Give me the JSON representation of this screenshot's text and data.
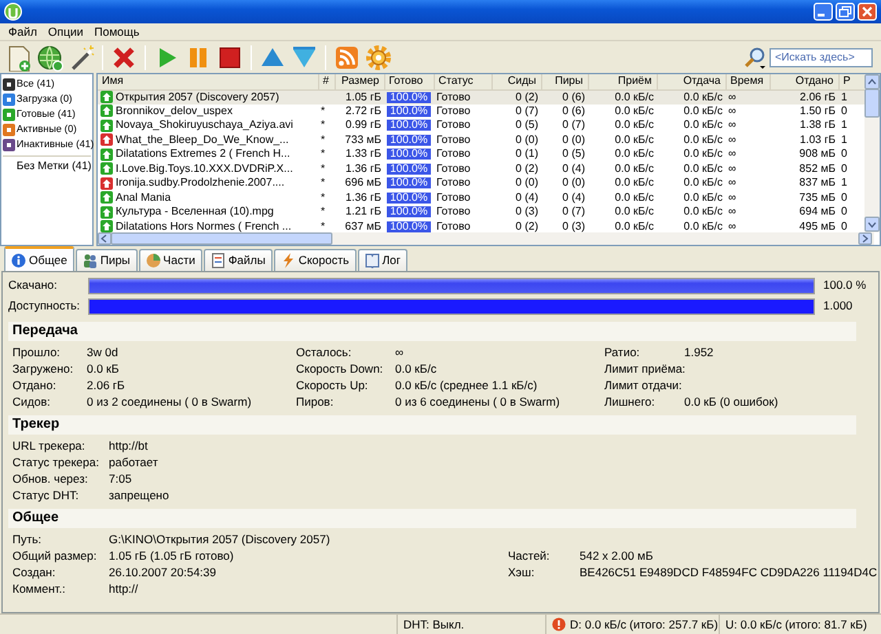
{
  "menu": [
    "Файл",
    "Опции",
    "Помощь"
  ],
  "search": {
    "placeholder": "<Искать здесь>"
  },
  "sidebar": {
    "items": [
      {
        "label": "Все (41)",
        "color": "#303030",
        "selected": false
      },
      {
        "label": "Загрузка (0)",
        "color": "#2f7fe0",
        "selected": false
      },
      {
        "label": "Готовые (41)",
        "color": "#2aa82a",
        "selected": false
      },
      {
        "label": "Активные (0)",
        "color": "#e07820",
        "selected": false
      },
      {
        "label": "Инактивные (41)",
        "color": "#6a4a8a",
        "selected": false
      }
    ],
    "labels": [
      {
        "label": "Без Метки (41)"
      }
    ]
  },
  "torrents": {
    "columns": [
      "Имя",
      "#",
      "Размер",
      "Готово",
      "Статус",
      "Сиды",
      "Пиры",
      "Приём",
      "Отдача",
      "Время",
      "Отдано",
      "Р"
    ],
    "rows": [
      {
        "kind": "done",
        "selected": true,
        "name": "Открытия 2057 (Discovery 2057)",
        "size": "1.05 гБ",
        "done": "100.0%",
        "level": 1,
        "status": "Готово",
        "seeds": "0 (2)",
        "peers": "0 (6)",
        "down": "0.0 кБ/с",
        "up": "0.0 кБ/с",
        "eta": "∞",
        "uploaded": "2.06 гБ",
        "column_12": "1"
      },
      {
        "kind": "done",
        "selected": false,
        "name": "Bronnikov_delov_uspex",
        "queue": "*",
        "size": "2.72 гБ",
        "done": "100.0%",
        "level": 1,
        "status": "Готово",
        "seeds": "0 (7)",
        "peers": "0 (6)",
        "down": "0.0 кБ/с",
        "up": "0.0 кБ/с",
        "eta": "∞",
        "uploaded": "1.50 гБ",
        "column_12": "0"
      },
      {
        "kind": "done",
        "selected": false,
        "name": "Novaya_Shokiruyuschaya_Aziya.avi",
        "queue": "*",
        "size": "0.99 гБ",
        "done": "100.0%",
        "level": 1,
        "status": "Готово",
        "seeds": "0 (5)",
        "peers": "0 (7)",
        "down": "0.0 кБ/с",
        "up": "0.0 кБ/с",
        "eta": "∞",
        "uploaded": "1.38 гБ",
        "column_12": "1"
      },
      {
        "kind": "error",
        "selected": false,
        "name": "What_the_Bleep_Do_We_Know_...",
        "queue": "*",
        "size": "733 мБ",
        "done": "100.0%",
        "level": 1,
        "status": "Готово",
        "seeds": "0 (0)",
        "peers": "0 (0)",
        "down": "0.0 кБ/с",
        "up": "0.0 кБ/с",
        "eta": "∞",
        "uploaded": "1.03 гБ",
        "column_12": "1"
      },
      {
        "kind": "done",
        "selected": false,
        "name": "Dilatations Extremes 2 ( French H...",
        "queue": "*",
        "size": "1.33 гБ",
        "done": "100.0%",
        "level": 1,
        "status": "Готово",
        "seeds": "0 (1)",
        "peers": "0 (5)",
        "down": "0.0 кБ/с",
        "up": "0.0 кБ/с",
        "eta": "∞",
        "uploaded": "908 мБ",
        "column_12": "0"
      },
      {
        "kind": "done",
        "selected": false,
        "name": "I.Love.Big.Toys.10.XXX.DVDRiP.X...",
        "queue": "*",
        "size": "1.36 гБ",
        "done": "100.0%",
        "level": 1,
        "status": "Готово",
        "seeds": "0 (2)",
        "peers": "0 (4)",
        "down": "0.0 кБ/с",
        "up": "0.0 кБ/с",
        "eta": "∞",
        "uploaded": "852 мБ",
        "column_12": "0"
      },
      {
        "kind": "error",
        "selected": false,
        "name": "Ironija.sudby.Prodolzhenie.2007....",
        "queue": "*",
        "size": "696 мБ",
        "done": "100.0%",
        "level": 1,
        "status": "Готово",
        "seeds": "0 (0)",
        "peers": "0 (0)",
        "down": "0.0 кБ/с",
        "up": "0.0 кБ/с",
        "eta": "∞",
        "uploaded": "837 мБ",
        "column_12": "1"
      },
      {
        "kind": "done",
        "selected": false,
        "name": "Anal Mania",
        "queue": "*",
        "size": "1.36 гБ",
        "done": "100.0%",
        "level": 1,
        "status": "Готово",
        "seeds": "0 (4)",
        "peers": "0 (4)",
        "down": "0.0 кБ/с",
        "up": "0.0 кБ/с",
        "eta": "∞",
        "uploaded": "735 мБ",
        "column_12": "0"
      },
      {
        "kind": "done",
        "selected": false,
        "name": "Культура - Вселенная  (10).mpg",
        "queue": "*",
        "size": "1.21 гБ",
        "done": "100.0%",
        "level": 1,
        "status": "Готово",
        "seeds": "0 (3)",
        "peers": "0 (7)",
        "down": "0.0 кБ/с",
        "up": "0.0 кБ/с",
        "eta": "∞",
        "uploaded": "694 мБ",
        "column_12": "0"
      },
      {
        "kind": "done",
        "selected": false,
        "name": "Dilatations Hors Normes ( French ...",
        "queue": "*",
        "size": "637 мБ",
        "done": "100.0%",
        "level": 1,
        "status": "Готово",
        "seeds": "0 (2)",
        "peers": "0 (3)",
        "down": "0.0 кБ/с",
        "up": "0.0 кБ/с",
        "eta": "∞",
        "uploaded": "495 мБ",
        "column_12": "0"
      }
    ]
  },
  "tabs": [
    {
      "label": "Общее",
      "selected": true
    },
    {
      "label": "Пиры",
      "selected": false
    },
    {
      "label": "Части",
      "selected": false
    },
    {
      "label": "Файлы",
      "selected": false
    },
    {
      "label": "Скорость",
      "selected": false
    },
    {
      "label": "Лог",
      "selected": false
    }
  ],
  "progress": [
    {
      "kind": "pieces",
      "label": "Скачано:",
      "level": 1,
      "reading": "100.0 %"
    },
    {
      "kind": "availability",
      "label": "Доступность:",
      "level": 1,
      "reading": "1.000"
    }
  ],
  "sections": [
    {
      "kind": "transfer",
      "title": "Передача",
      "rows": [
        [
          {
            "label": "Прошло:",
            "value": "3w 0d"
          },
          {
            "label": "Осталось:",
            "value": "∞"
          },
          {
            "label": "Ратио:",
            "value": "1.952"
          }
        ],
        [
          {
            "label": "Загружено:",
            "value": "0.0 кБ"
          },
          {
            "label": "Скорость Down:",
            "value": "0.0 кБ/с"
          },
          {
            "label": "Лимит приёма:"
          }
        ],
        [
          {
            "label": "Отдано:",
            "value": "2.06 гБ"
          },
          {
            "label": "Скорость Up:",
            "value": "0.0 кБ/с (среднее 1.1 кБ/с)"
          },
          {
            "label": "Лимит отдачи:"
          }
        ],
        [
          {
            "label": "Сидов:",
            "value": "0 из 2 соединены ( 0 в Swarm)"
          },
          {
            "label": "Пиров:",
            "value": "0 из 6 соединены ( 0 в Swarm)"
          },
          {
            "label": "Лишнего:",
            "value": "0.0 кБ (0 ошибок)"
          }
        ]
      ]
    },
    {
      "kind": "tracker",
      "title": "Трекер",
      "rows": [
        [
          {
            "label": "URL трекера:",
            "value": "http://bt"
          }
        ],
        [
          {
            "label": "Статус трекера:",
            "value": "работает"
          }
        ],
        [
          {
            "label": "Обнов. через:",
            "value": "7:05"
          }
        ],
        [
          {
            "label": "Статус DHT:",
            "value": "запрещено"
          }
        ]
      ]
    },
    {
      "kind": "general",
      "title": "Общее",
      "rows": [
        [
          {
            "label": "Путь:",
            "value": "G:\\KINO\\Открытия 2057 (Discovery 2057)"
          }
        ],
        [
          {
            "label": "Общий размер:",
            "value": "1.05 гБ  (1.05 гБ готово)"
          },
          {
            "label": "Частей:",
            "value": "542 x 2.00 мБ"
          }
        ],
        [
          {
            "label": "Создан:",
            "value": "26.10.2007 20:54:39"
          },
          {
            "label": "Хэш:",
            "value": "BE426C51 E9489DCD F48594FC CD9DA226 11194D4C"
          }
        ],
        [
          {
            "label": "Коммент.:",
            "value": "http://"
          }
        ]
      ]
    }
  ],
  "status_bar": {
    "dht": "DHT: Выкл.",
    "download": "D: 0.0 кБ/с  (итого: 257.7 кБ)",
    "upload": "U: 0.0 кБ/с  (итого: 81.7 кБ)"
  }
}
